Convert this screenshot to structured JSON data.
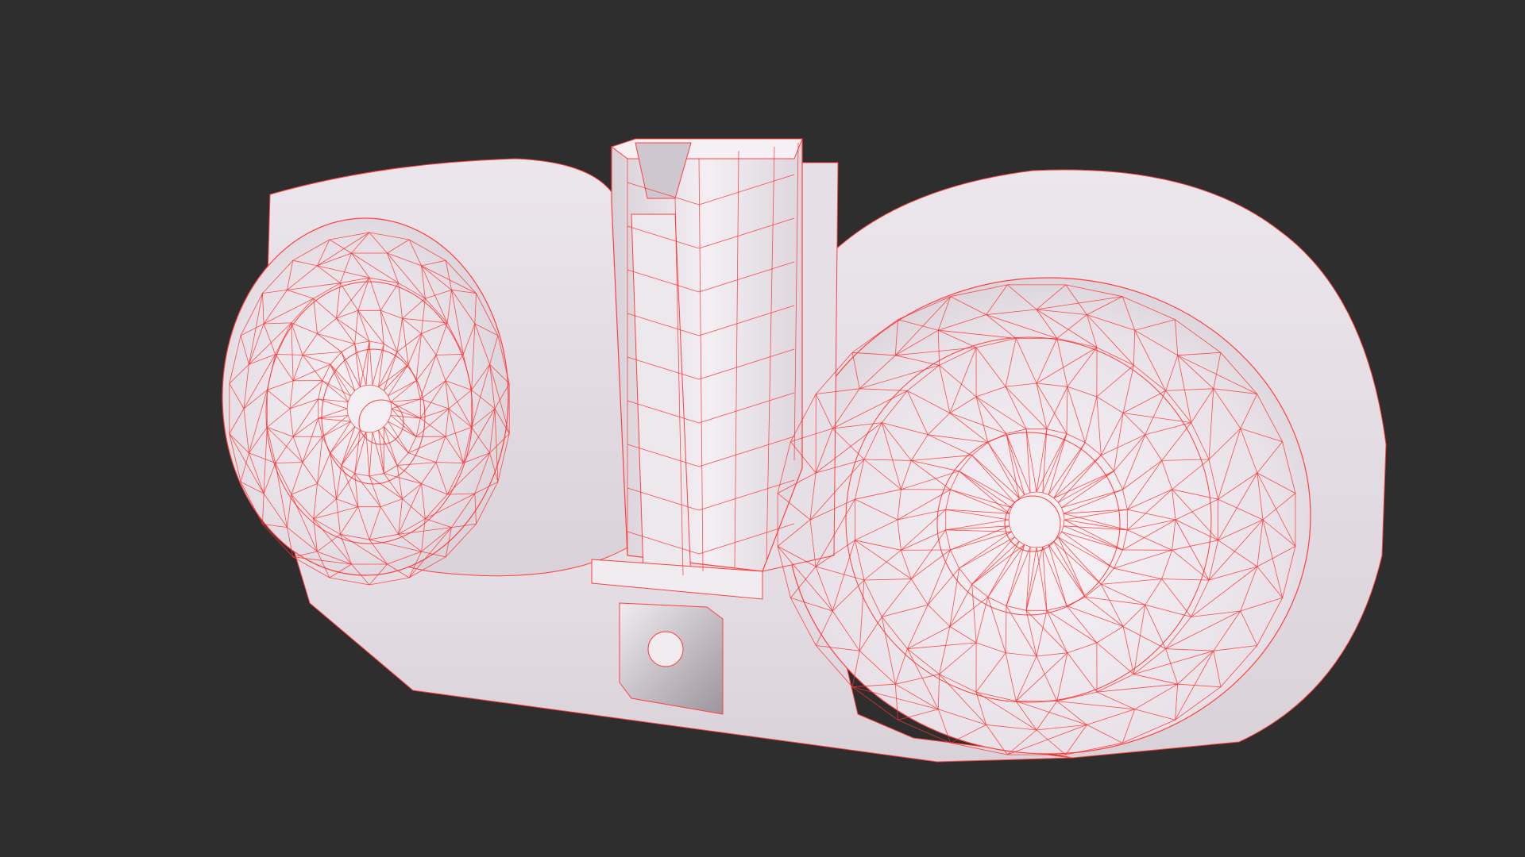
{
  "scene": {
    "background_color": "#2e2e2e",
    "mesh_color": "#e9e4e8",
    "wireframe_color": "#ff3030",
    "subject": "drum-magazine-wireframe-model"
  }
}
